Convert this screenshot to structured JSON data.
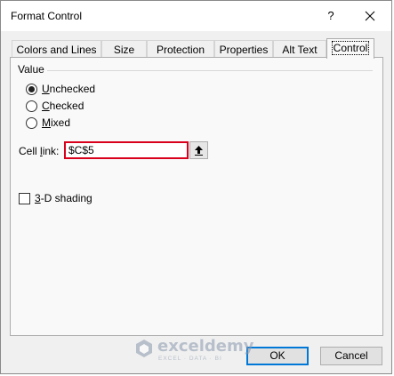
{
  "window": {
    "title": "Format Control",
    "help_label": "?",
    "close_icon": "close-icon"
  },
  "tabs": [
    {
      "label": "Colors and Lines",
      "active": false
    },
    {
      "label": "Size",
      "active": false
    },
    {
      "label": "Protection",
      "active": false
    },
    {
      "label": "Properties",
      "active": false
    },
    {
      "label": "Alt Text",
      "active": false
    },
    {
      "label": "Control",
      "active": true
    }
  ],
  "value_group": {
    "label": "Value",
    "options": [
      {
        "label": "Unchecked",
        "hotkey": "U",
        "rest": "nchecked",
        "selected": true
      },
      {
        "label": "Checked",
        "hotkey": "C",
        "rest": "hecked",
        "selected": false
      },
      {
        "label": "Mixed",
        "hotkey": "M",
        "rest": "ixed",
        "selected": false
      }
    ]
  },
  "cell_link": {
    "label_pre": "Cell ",
    "label_hotkey": "l",
    "label_post": "ink:",
    "value": "$C$5",
    "button_icon": "collapse-dialog-icon"
  },
  "shading": {
    "hotkey": "3",
    "rest": "-D shading",
    "checked": false
  },
  "buttons": {
    "ok_label": "OK",
    "cancel_label": "Cancel"
  },
  "watermark": {
    "name": "exceldemy",
    "tagline": "EXCEL · DATA · BI"
  },
  "colors": {
    "accent": "#0078d7",
    "highlight_border": "#d9001c"
  }
}
